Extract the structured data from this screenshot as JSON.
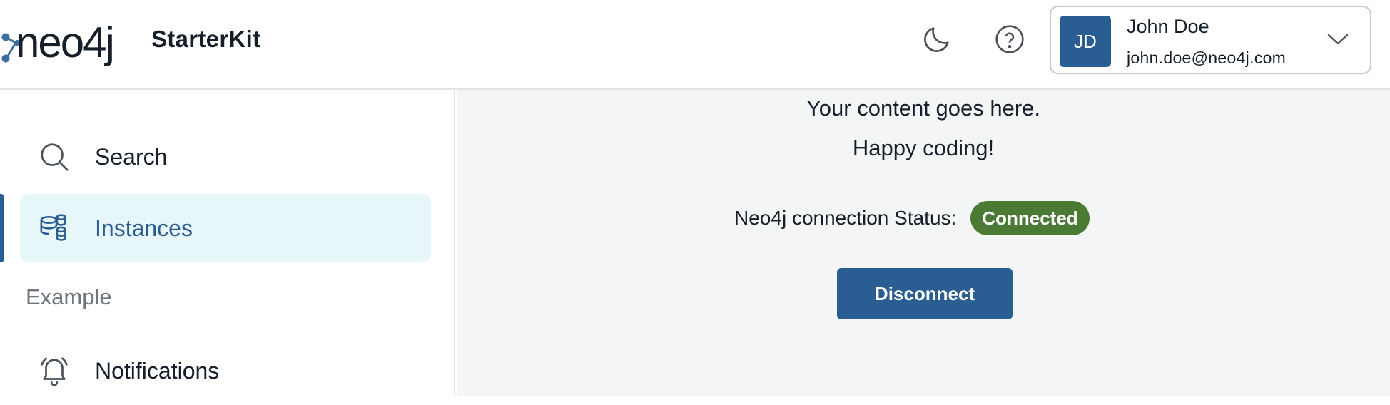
{
  "header": {
    "logo_text": "neo4j",
    "brand": "StarterKit",
    "theme_toggle_icon": "moon-icon",
    "help_icon": "question-circle-icon",
    "user": {
      "initials": "JD",
      "name": "John Doe",
      "email": "john.doe@neo4j.com",
      "menu_icon": "chevron-down-icon"
    }
  },
  "sidebar": {
    "items": [
      {
        "label": "Search",
        "icon": "search-icon",
        "active": false
      },
      {
        "label": "Instances",
        "icon": "database-instances-icon",
        "active": true
      }
    ],
    "section_label": "Example",
    "section_items": [
      {
        "label": "Notifications",
        "icon": "bell-icon",
        "active": false
      }
    ]
  },
  "main": {
    "line1": "Your content goes here.",
    "line2": "Happy coding!",
    "status_label": "Neo4j connection Status:",
    "status_value": "Connected",
    "disconnect_label": "Disconnect"
  },
  "colors": {
    "primary": "#2a5d91",
    "active_bg": "#e7f6f8",
    "success": "#4a7a33",
    "content_bg": "#f4f5f5"
  }
}
